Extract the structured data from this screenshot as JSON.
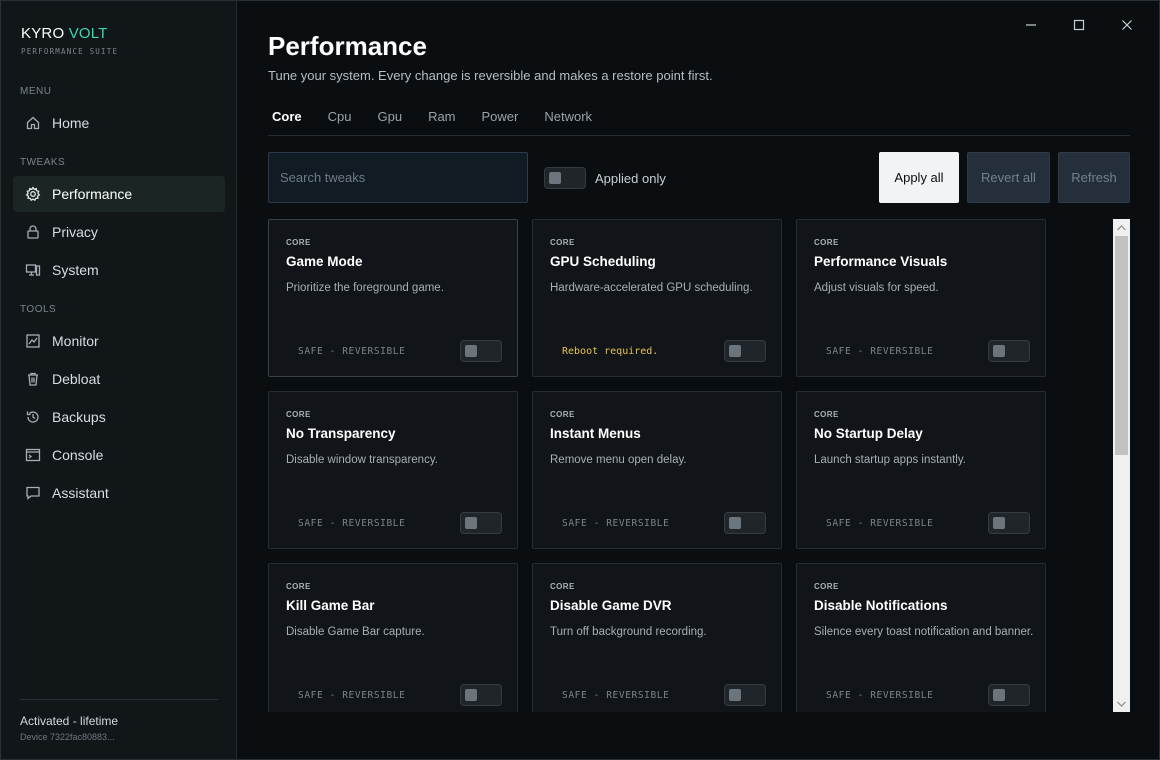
{
  "brand": {
    "name_part1": "KYRO",
    "name_part2": "VOLT",
    "subtitle": "PERFORMANCE SUITE"
  },
  "sidebar": {
    "sections": [
      {
        "label": "MENU"
      },
      {
        "label": "TWEAKS"
      },
      {
        "label": "TOOLS"
      }
    ],
    "items": [
      {
        "label": "Home",
        "icon": "home-icon"
      },
      {
        "label": "Performance",
        "icon": "gear-icon",
        "active": true
      },
      {
        "label": "Privacy",
        "icon": "lock-icon"
      },
      {
        "label": "System",
        "icon": "system-icon"
      },
      {
        "label": "Monitor",
        "icon": "monitor-chart-icon"
      },
      {
        "label": "Debloat",
        "icon": "trash-icon"
      },
      {
        "label": "Backups",
        "icon": "history-icon"
      },
      {
        "label": "Console",
        "icon": "console-icon"
      },
      {
        "label": "Assistant",
        "icon": "chat-icon"
      }
    ],
    "license": "Activated - lifetime",
    "device": "Device 7322fac80883..."
  },
  "page": {
    "title": "Performance",
    "subtitle": "Tune your system. Every change is reversible and makes a restore point first."
  },
  "tabs": [
    {
      "label": "Core",
      "active": true
    },
    {
      "label": "Cpu"
    },
    {
      "label": "Gpu"
    },
    {
      "label": "Ram"
    },
    {
      "label": "Power"
    },
    {
      "label": "Network"
    }
  ],
  "toolbar": {
    "search_placeholder": "Search tweaks",
    "search_value": "",
    "applied_only_label": "Applied only",
    "applied_only": false,
    "apply_all": "Apply all",
    "revert_all": "Revert all",
    "refresh": "Refresh"
  },
  "cards": [
    {
      "category": "CORE",
      "title": "Game Mode",
      "desc": "Prioritize the foreground game.",
      "status": "SAFE - REVERSIBLE",
      "warn": false,
      "enabled": false
    },
    {
      "category": "CORE",
      "title": "GPU Scheduling",
      "desc": "Hardware-accelerated GPU scheduling.",
      "status": "Reboot required.",
      "warn": true,
      "enabled": false
    },
    {
      "category": "CORE",
      "title": "Performance Visuals",
      "desc": "Adjust visuals for speed.",
      "status": "SAFE - REVERSIBLE",
      "warn": false,
      "enabled": false
    },
    {
      "category": "CORE",
      "title": "No Transparency",
      "desc": "Disable window transparency.",
      "status": "SAFE - REVERSIBLE",
      "warn": false,
      "enabled": false
    },
    {
      "category": "CORE",
      "title": "Instant Menus",
      "desc": "Remove menu open delay.",
      "status": "SAFE - REVERSIBLE",
      "warn": false,
      "enabled": false
    },
    {
      "category": "CORE",
      "title": "No Startup Delay",
      "desc": "Launch startup apps instantly.",
      "status": "SAFE - REVERSIBLE",
      "warn": false,
      "enabled": false
    },
    {
      "category": "CORE",
      "title": "Kill Game Bar",
      "desc": "Disable Game Bar capture.",
      "status": "SAFE - REVERSIBLE",
      "warn": false,
      "enabled": false
    },
    {
      "category": "CORE",
      "title": "Disable Game DVR",
      "desc": "Turn off background recording.",
      "status": "SAFE - REVERSIBLE",
      "warn": false,
      "enabled": false
    },
    {
      "category": "CORE",
      "title": "Disable Notifications",
      "desc": "Silence every toast notification and banner.",
      "status": "SAFE - REVERSIBLE",
      "warn": false,
      "enabled": false
    }
  ],
  "colors": {
    "accent": "#3fd6b0",
    "warning": "#e7c24d",
    "background": "#0a0e11",
    "sidebar": "#111619"
  }
}
